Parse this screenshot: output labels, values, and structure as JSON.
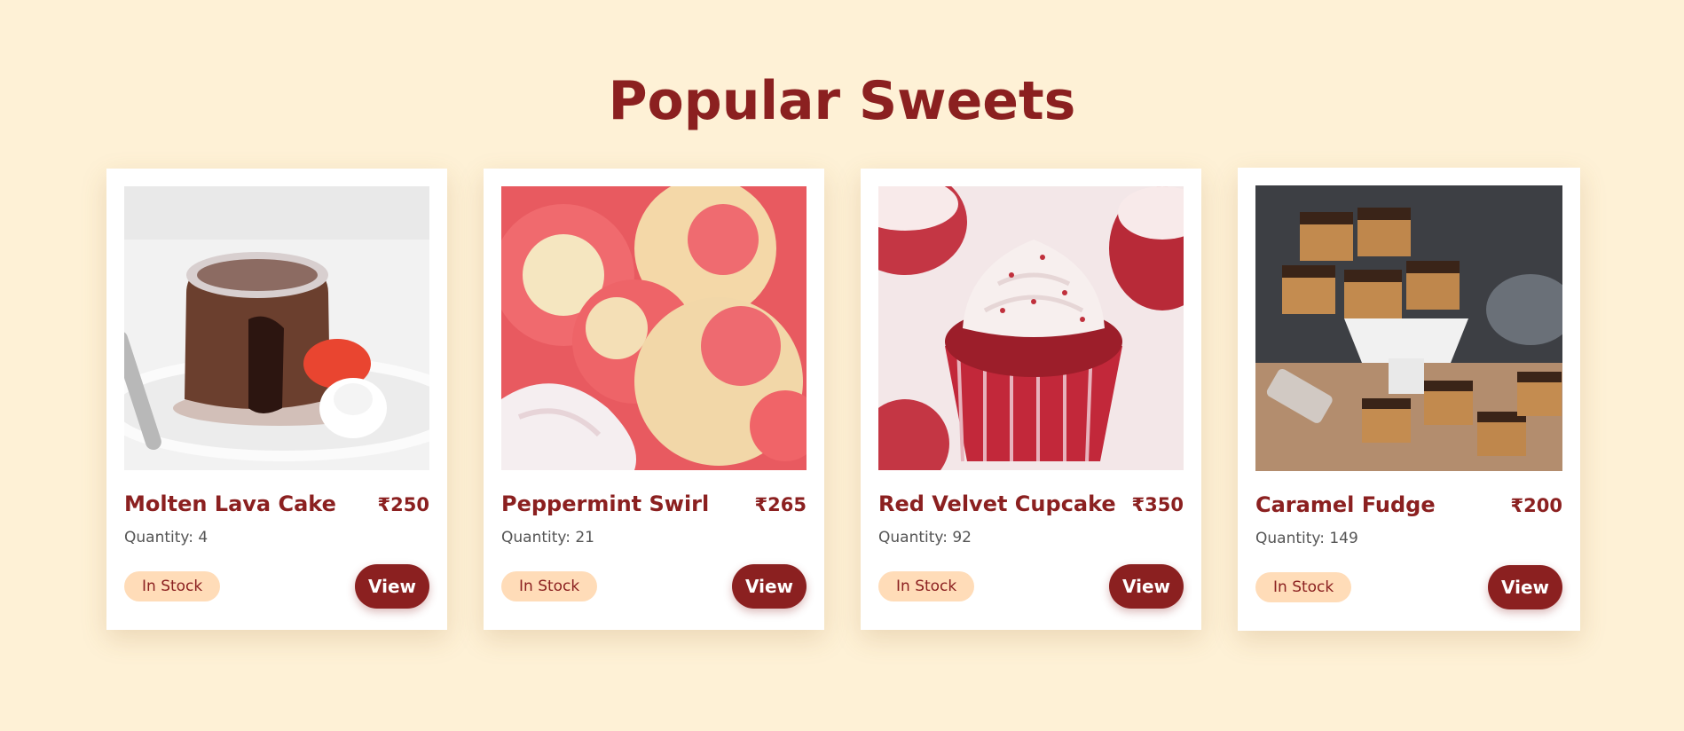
{
  "page": {
    "title": "Popular Sweets"
  },
  "colors": {
    "background": "#fef1d6",
    "accent": "#8b2020",
    "badge_bg": "#ffdcb8"
  },
  "cards": [
    {
      "name": "Molten Lava Cake",
      "price": "₹250",
      "quantity": "Quantity: 4",
      "status": "In Stock",
      "action": "View",
      "image": "molten-lava-cake-photo"
    },
    {
      "name": "Peppermint Swirl",
      "price": "₹265",
      "quantity": "Quantity: 21",
      "status": "In Stock",
      "action": "View",
      "image": "peppermint-swirl-photo"
    },
    {
      "name": "Red Velvet Cupcake",
      "price": "₹350",
      "quantity": "Quantity: 92",
      "status": "In Stock",
      "action": "View",
      "image": "red-velvet-cupcake-photo"
    },
    {
      "name": "Caramel Fudge",
      "price": "₹200",
      "quantity": "Quantity: 149",
      "status": "In Stock",
      "action": "View",
      "image": "caramel-fudge-photo"
    }
  ]
}
